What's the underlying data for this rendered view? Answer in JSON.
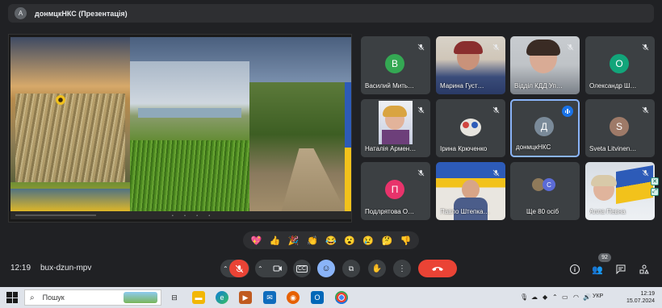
{
  "presentation_banner": {
    "avatar_letter": "A",
    "title": "донмцкНКС (Презентація)"
  },
  "participants": [
    {
      "name": "Василий Мить…",
      "initial": "В",
      "avatar_color": "#34a853",
      "muted": true,
      "has_video": false
    },
    {
      "name": "Марина Густ…",
      "muted": true,
      "has_video": true
    },
    {
      "name": "Відділ КДД Уп…",
      "muted": true,
      "has_video": true
    },
    {
      "name": "Олександр Ш…",
      "initial": "О",
      "avatar_color": "#12a57a",
      "muted": true,
      "has_video": false
    },
    {
      "name": "Наталія Армен…",
      "muted": true,
      "has_video": true
    },
    {
      "name": "Ірина Крюченко",
      "muted": true,
      "has_video": true
    },
    {
      "name": "донмцкНКС",
      "initial": "Д",
      "avatar_color": "#7a8a99",
      "muted": false,
      "speaking": true,
      "has_video": false
    },
    {
      "name": "Sveta Litvinen…",
      "initial": "S",
      "avatar_color": "#9e7a68",
      "muted": true,
      "has_video": false
    },
    {
      "name": "Подлрятова О…",
      "initial": "П",
      "avatar_color": "#e8336b",
      "muted": true,
      "has_video": false
    },
    {
      "name": "Павло Штепка…",
      "muted": true,
      "has_video": true
    },
    {
      "name": "Ще 80 осіб",
      "initial": "С",
      "avatar_color": "#5b6bd6",
      "more_count": true
    },
    {
      "name": "Алла Певна",
      "muted": true,
      "has_video": true
    }
  ],
  "reactions": [
    "💖",
    "👍",
    "🎉",
    "👏",
    "😂",
    "😮",
    "😢",
    "🤔",
    "👎"
  ],
  "bottom_bar": {
    "time": "12:19",
    "meeting_code": "bux-dzun-mpv",
    "participants_badge": "92"
  },
  "taskbar": {
    "search_placeholder": "Пошук",
    "language": "УКР",
    "clock_time": "12:19",
    "clock_date": "15.07.2024"
  },
  "colors": {
    "background": "#202124",
    "tile": "#3c4043",
    "end_call": "#ea4335",
    "accent": "#8ab4f8"
  }
}
